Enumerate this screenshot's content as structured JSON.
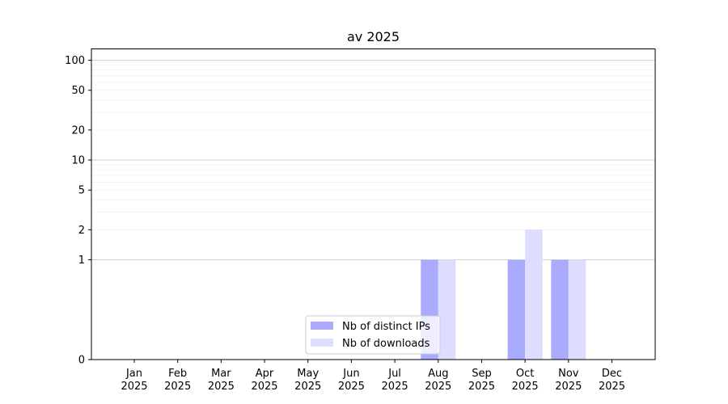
{
  "chart_data": {
    "type": "bar",
    "title": "av 2025",
    "xlabel": "",
    "ylabel": "",
    "categories": [
      "Jan\n2025",
      "Feb\n2025",
      "Mar\n2025",
      "Apr\n2025",
      "May\n2025",
      "Jun\n2025",
      "Jul\n2025",
      "Aug\n2025",
      "Sep\n2025",
      "Oct\n2025",
      "Nov\n2025",
      "Dec\n2025"
    ],
    "series": [
      {
        "name": "Nb of distinct IPs",
        "color": "#aaaaff",
        "values": [
          0,
          0,
          0,
          0,
          0,
          0,
          0,
          1,
          0,
          1,
          1,
          0
        ]
      },
      {
        "name": "Nb of downloads",
        "color": "#ddddff",
        "values": [
          0,
          0,
          0,
          0,
          0,
          0,
          0,
          1,
          0,
          2,
          1,
          0
        ]
      }
    ],
    "y_scale": "symlog",
    "ylim": [
      0,
      130
    ],
    "yticks": [
      0,
      1,
      2,
      5,
      10,
      20,
      50,
      100
    ],
    "grid": true,
    "legend_position": "lower-center"
  }
}
